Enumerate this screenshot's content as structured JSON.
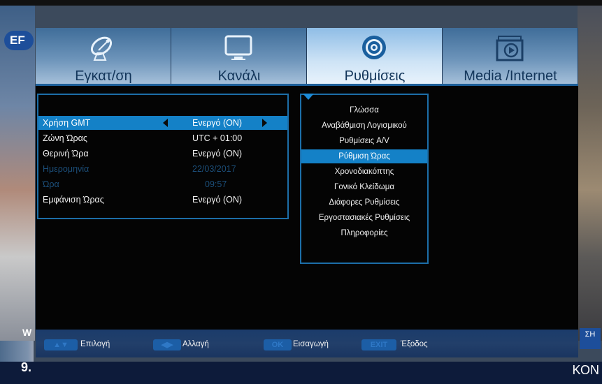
{
  "background": {
    "channel_logo": "EF",
    "ticker_time": "9.",
    "ticker_right_text": "ΚΟΝ",
    "left_side_text": "W",
    "right_badge": "ΣΗ"
  },
  "tabs": [
    {
      "label": "Εγκατ/ση",
      "icon": "satellite-dish-icon",
      "active": false
    },
    {
      "label": "Κανάλι",
      "icon": "tv-monitor-icon",
      "active": false
    },
    {
      "label": "Ρυθμίσεις",
      "icon": "gear-icon",
      "active": true
    },
    {
      "label": "Media /Internet",
      "icon": "media-folder-icon",
      "active": false
    }
  ],
  "time_settings": [
    {
      "label": "Χρήση GMT",
      "value": "Ενεργό (ON)",
      "selected": true,
      "disabled": false
    },
    {
      "label": "Ζώνη Ώρας",
      "value": "UTC + 01:00",
      "selected": false,
      "disabled": false
    },
    {
      "label": "Θερινή Ώρα",
      "value": "Ενεργό (ON)",
      "selected": false,
      "disabled": false
    },
    {
      "label": "Ημερομηνία",
      "value": "22/03/2017",
      "selected": false,
      "disabled": true
    },
    {
      "label": "Ώρα",
      "value": "09:57",
      "selected": false,
      "disabled": true
    },
    {
      "label": "Εμφάνιση Ώρας",
      "value": "Ενεργό (ON)",
      "selected": false,
      "disabled": false
    }
  ],
  "submenu": [
    {
      "label": "Γλώσσα",
      "selected": false
    },
    {
      "label": "Αναβάθμιση Λογισμικού",
      "selected": false
    },
    {
      "label": "Ρυθμίσεις A/V",
      "selected": false
    },
    {
      "label": "Ρύθμιση Ώρας",
      "selected": true
    },
    {
      "label": "Χρονοδιακόπτης",
      "selected": false
    },
    {
      "label": "Γονικό Κλείδωμα",
      "selected": false
    },
    {
      "label": "Διάφορες Ρυθμίσεις",
      "selected": false
    },
    {
      "label": "Εργοστασιακές Ρυθμίσεις",
      "selected": false
    },
    {
      "label": "Πληροφορίες",
      "selected": false
    }
  ],
  "help_bar": [
    {
      "key": "▲▼",
      "label": "Επιλογή"
    },
    {
      "key": "◀▶",
      "label": "Αλλαγή"
    },
    {
      "key": "OK",
      "label": "Εισαγωγή"
    },
    {
      "key": "EXIT",
      "label": "Έξοδος"
    }
  ],
  "colors": {
    "accent": "#1481c7",
    "panel_border": "#1c6ea8",
    "disabled_text": "#1c4f7a",
    "help_bar": "#1b3c6b"
  }
}
